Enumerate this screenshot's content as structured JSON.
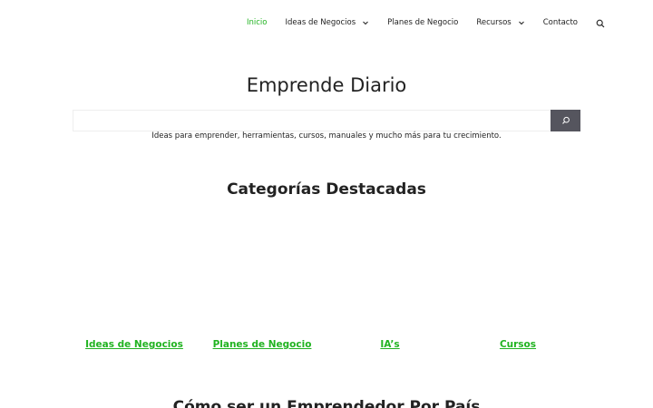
{
  "nav": {
    "items": [
      {
        "label": "Inicio",
        "active": true
      },
      {
        "label": "Ideas de Negocios",
        "dropdown": true
      },
      {
        "label": "Planes de Negocio"
      },
      {
        "label": "Recursos",
        "dropdown": true
      },
      {
        "label": "Contacto"
      }
    ],
    "search_icon": "search-icon"
  },
  "site": {
    "title": "Emprende Diario",
    "tagline": "Ideas para emprender, herramientas, cursos, manuales y mucho más para tu crecimiento."
  },
  "search": {
    "value": "",
    "button_icon": "search-icon"
  },
  "featured": {
    "title": "Categorías Destacadas",
    "categories": [
      {
        "label": "Ideas de Negocios"
      },
      {
        "label": "Planes de Negocio"
      },
      {
        "label": "IA’s"
      },
      {
        "label": "Cursos"
      }
    ]
  },
  "next_section": {
    "title": "Cómo ser un Emprendedor Por País"
  },
  "colors": {
    "accent_green": "#21b321",
    "text": "#222222",
    "search_button": "#55555e"
  }
}
